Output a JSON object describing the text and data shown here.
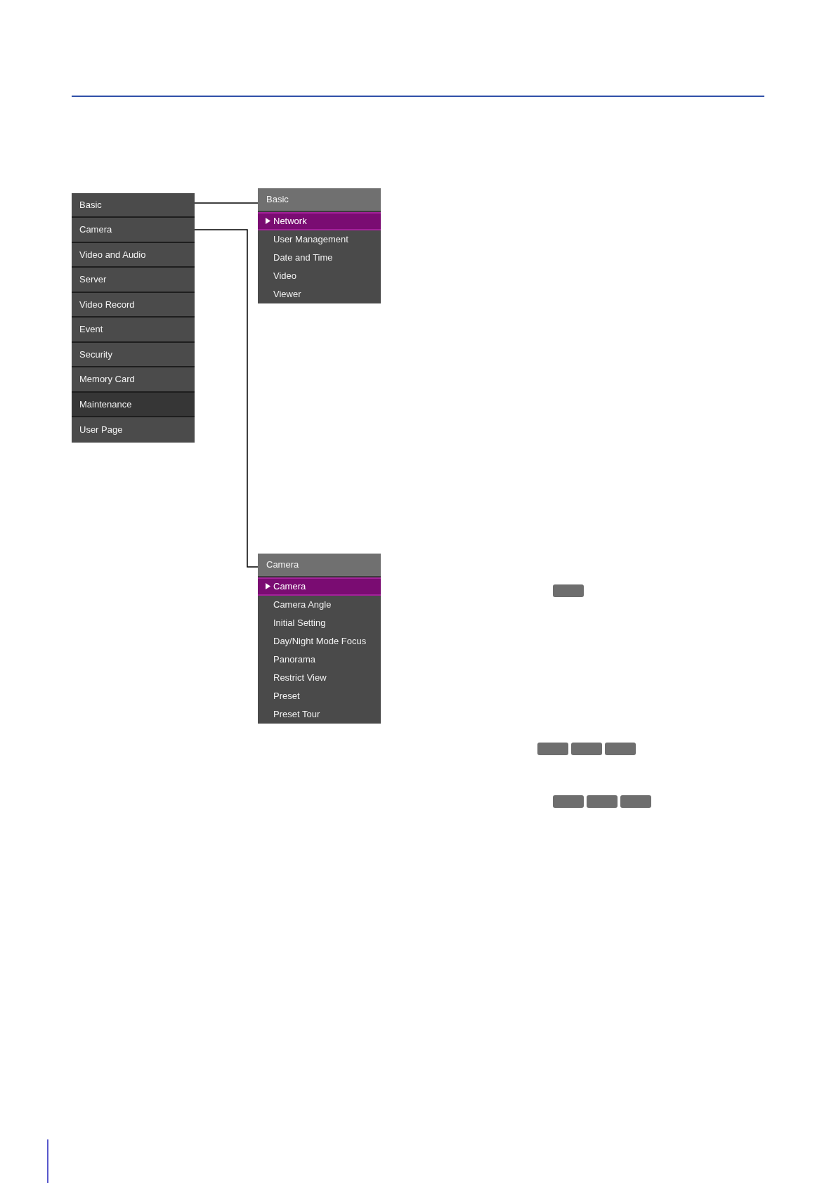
{
  "main_menu": {
    "items": [
      {
        "label": "Basic",
        "selected": false
      },
      {
        "label": "Camera",
        "selected": false
      },
      {
        "label": "Video and Audio",
        "selected": false
      },
      {
        "label": "Server",
        "selected": false
      },
      {
        "label": "Video Record",
        "selected": false
      },
      {
        "label": "Event",
        "selected": false
      },
      {
        "label": "Security",
        "selected": false
      },
      {
        "label": "Memory Card",
        "selected": false
      },
      {
        "label": "Maintenance",
        "selected": true
      },
      {
        "label": "User Page",
        "selected": false
      }
    ]
  },
  "submenus": [
    {
      "title": "Basic",
      "items": [
        {
          "label": "Network",
          "selected": true
        },
        {
          "label": "User Management",
          "selected": false
        },
        {
          "label": "Date and Time",
          "selected": false
        },
        {
          "label": "Video",
          "selected": false
        },
        {
          "label": "Viewer",
          "selected": false
        }
      ]
    },
    {
      "title": "Camera",
      "items": [
        {
          "label": "Camera",
          "selected": true
        },
        {
          "label": "Camera Angle",
          "selected": false
        },
        {
          "label": "Initial Setting",
          "selected": false
        },
        {
          "label": "Day/Night Mode Focus",
          "selected": false
        },
        {
          "label": "Panorama",
          "selected": false
        },
        {
          "label": "Restrict View",
          "selected": false
        },
        {
          "label": "Preset",
          "selected": false
        },
        {
          "label": "Preset Tour",
          "selected": false
        }
      ]
    }
  ],
  "button_groups": [
    {
      "buttons": [
        {
          "kind": "blank"
        }
      ]
    },
    {
      "buttons": [
        {
          "kind": "blank"
        },
        {
          "kind": "blank"
        },
        {
          "kind": "blank"
        }
      ]
    },
    {
      "buttons": [
        {
          "kind": "blank"
        },
        {
          "kind": "blank"
        },
        {
          "kind": "blank"
        }
      ]
    }
  ]
}
